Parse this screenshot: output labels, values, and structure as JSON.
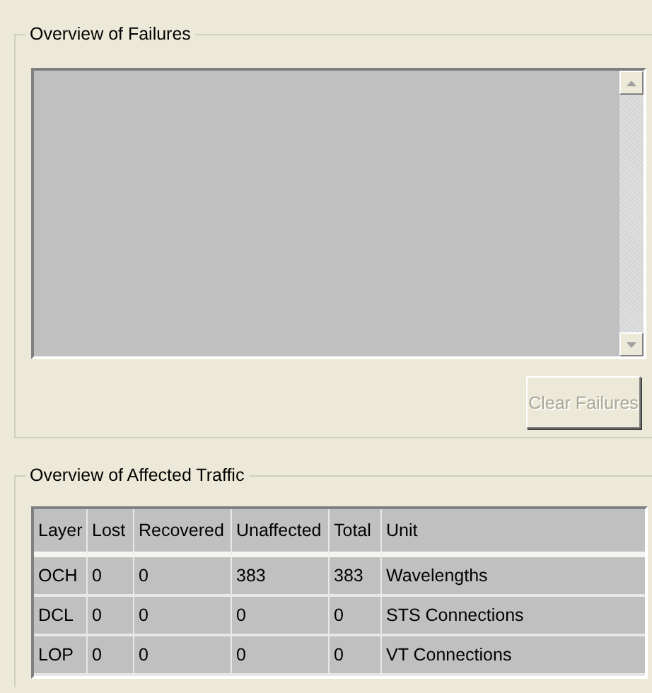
{
  "failures": {
    "title": "Overview of Failures",
    "clear_button": {
      "label": "Clear Failures",
      "disabled": true
    }
  },
  "traffic": {
    "title": "Overview of Affected Traffic",
    "columns": [
      "Layer",
      "Lost",
      "Recovered",
      "Unaffected",
      "Total",
      "Unit"
    ],
    "rows": [
      [
        "OCH",
        "0",
        "0",
        "383",
        "383",
        "Wavelengths"
      ],
      [
        "DCL",
        "0",
        "0",
        "0",
        "0",
        "STS Connections"
      ],
      [
        "LOP",
        "0",
        "0",
        "0",
        "0",
        "VT Connections"
      ]
    ]
  }
}
